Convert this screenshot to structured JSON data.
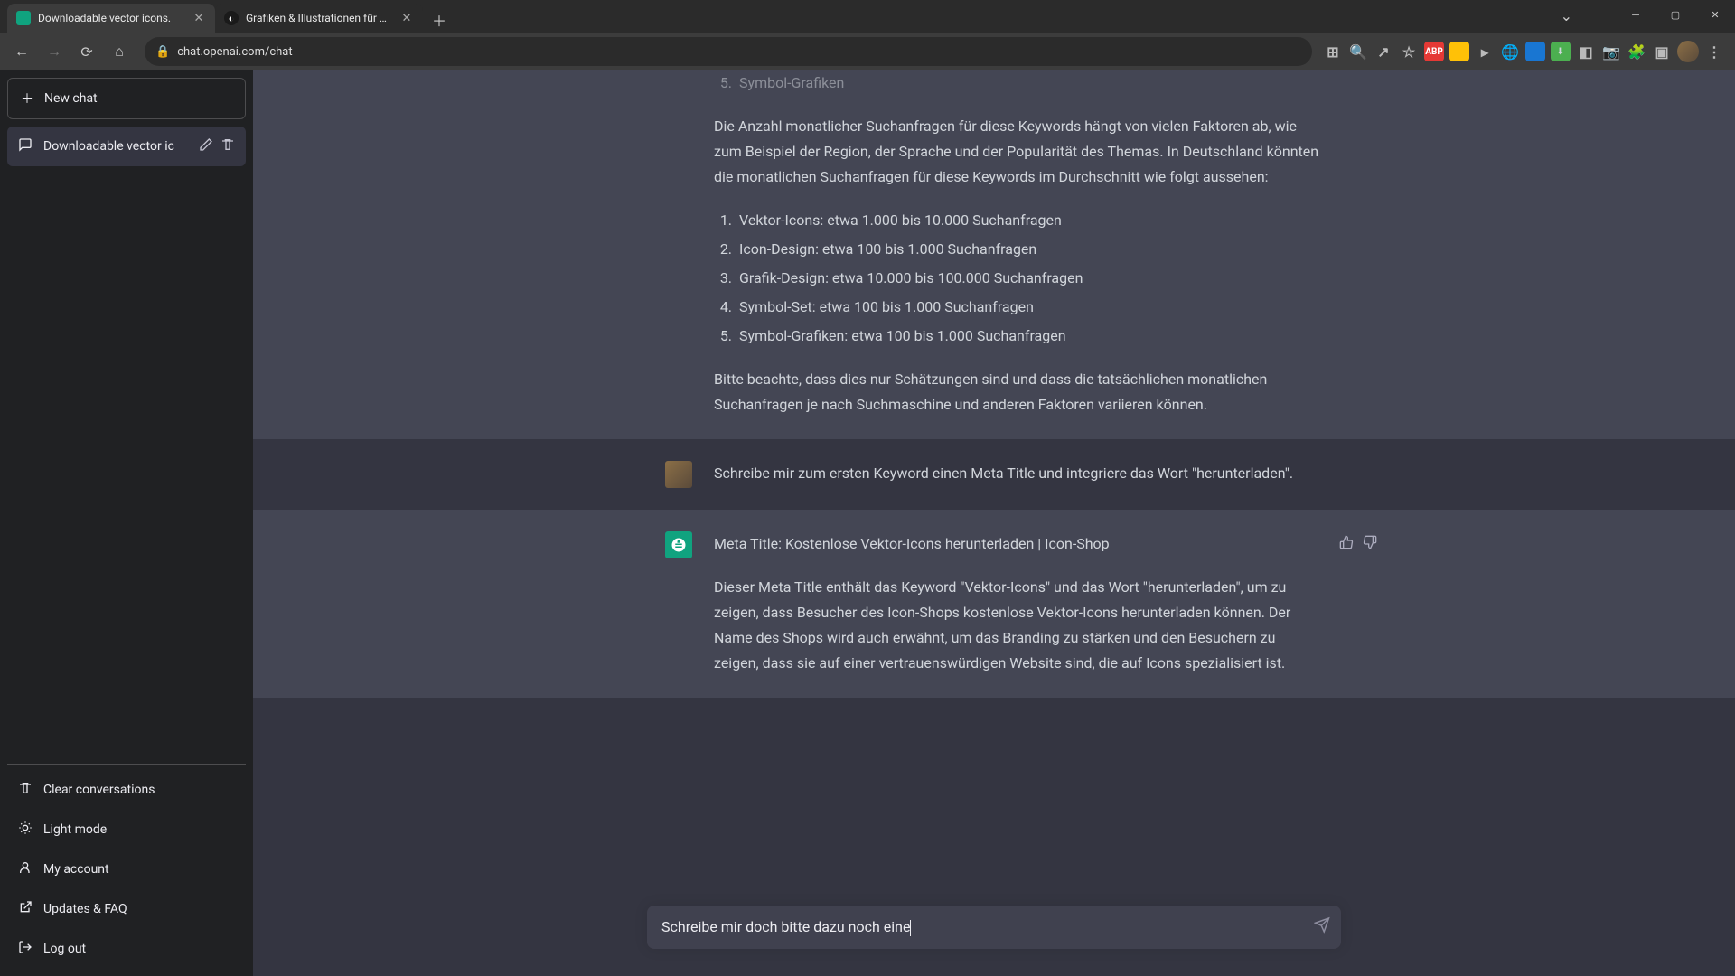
{
  "browser": {
    "tabs": [
      {
        "title": "Downloadable vector icons.",
        "active": true
      },
      {
        "title": "Grafiken & Illustrationen für Vekt",
        "active": false
      }
    ],
    "url": "chat.openai.com/chat"
  },
  "sidebar": {
    "new_chat": "New chat",
    "conversations": [
      {
        "title": "Downloadable vector ic"
      }
    ],
    "footer": {
      "clear": "Clear conversations",
      "light_mode": "Light mode",
      "account": "My account",
      "updates": "Updates & FAQ",
      "logout": "Log out"
    }
  },
  "chat": {
    "ai_response_1": {
      "partial_list_item": "Symbol-Grafiken",
      "paragraph_1": "Die Anzahl monatlicher Suchanfragen für diese Keywords hängt von vielen Faktoren ab, wie zum Beispiel der Region, der Sprache und der Popularität des Themas. In Deutschland könnten die monatlichen Suchanfragen für diese Keywords im Durchschnitt wie folgt aussehen:",
      "list": [
        "Vektor-Icons: etwa 1.000 bis 10.000 Suchanfragen",
        "Icon-Design: etwa 100 bis 1.000 Suchanfragen",
        "Grafik-Design: etwa 10.000 bis 100.000 Suchanfragen",
        "Symbol-Set: etwa 100 bis 1.000 Suchanfragen",
        "Symbol-Grafiken: etwa 100 bis 1.000 Suchanfragen"
      ],
      "paragraph_2": "Bitte beachte, dass dies nur Schätzungen sind und dass die tatsächlichen monatlichen Suchanfragen je nach Suchmaschine und anderen Faktoren variieren können."
    },
    "user_msg_1": "Schreibe mir zum ersten Keyword einen Meta Title und integriere das Wort \"herunterladen\".",
    "ai_response_2": {
      "line_1": "Meta Title: Kostenlose Vektor-Icons herunterladen | Icon-Shop",
      "paragraph_1": "Dieser Meta Title enthält das Keyword \"Vektor-Icons\" und das Wort \"herunterladen\", um zu zeigen, dass Besucher des Icon-Shops kostenlose Vektor-Icons herunterladen können. Der Name des Shops wird auch erwähnt, um das Branding zu stärken und den Besuchern zu zeigen, dass sie auf einer vertrauenswürdigen Website sind, die auf Icons spezialisiert ist."
    }
  },
  "input": {
    "value": "Schreibe mir doch bitte dazu noch eine"
  }
}
